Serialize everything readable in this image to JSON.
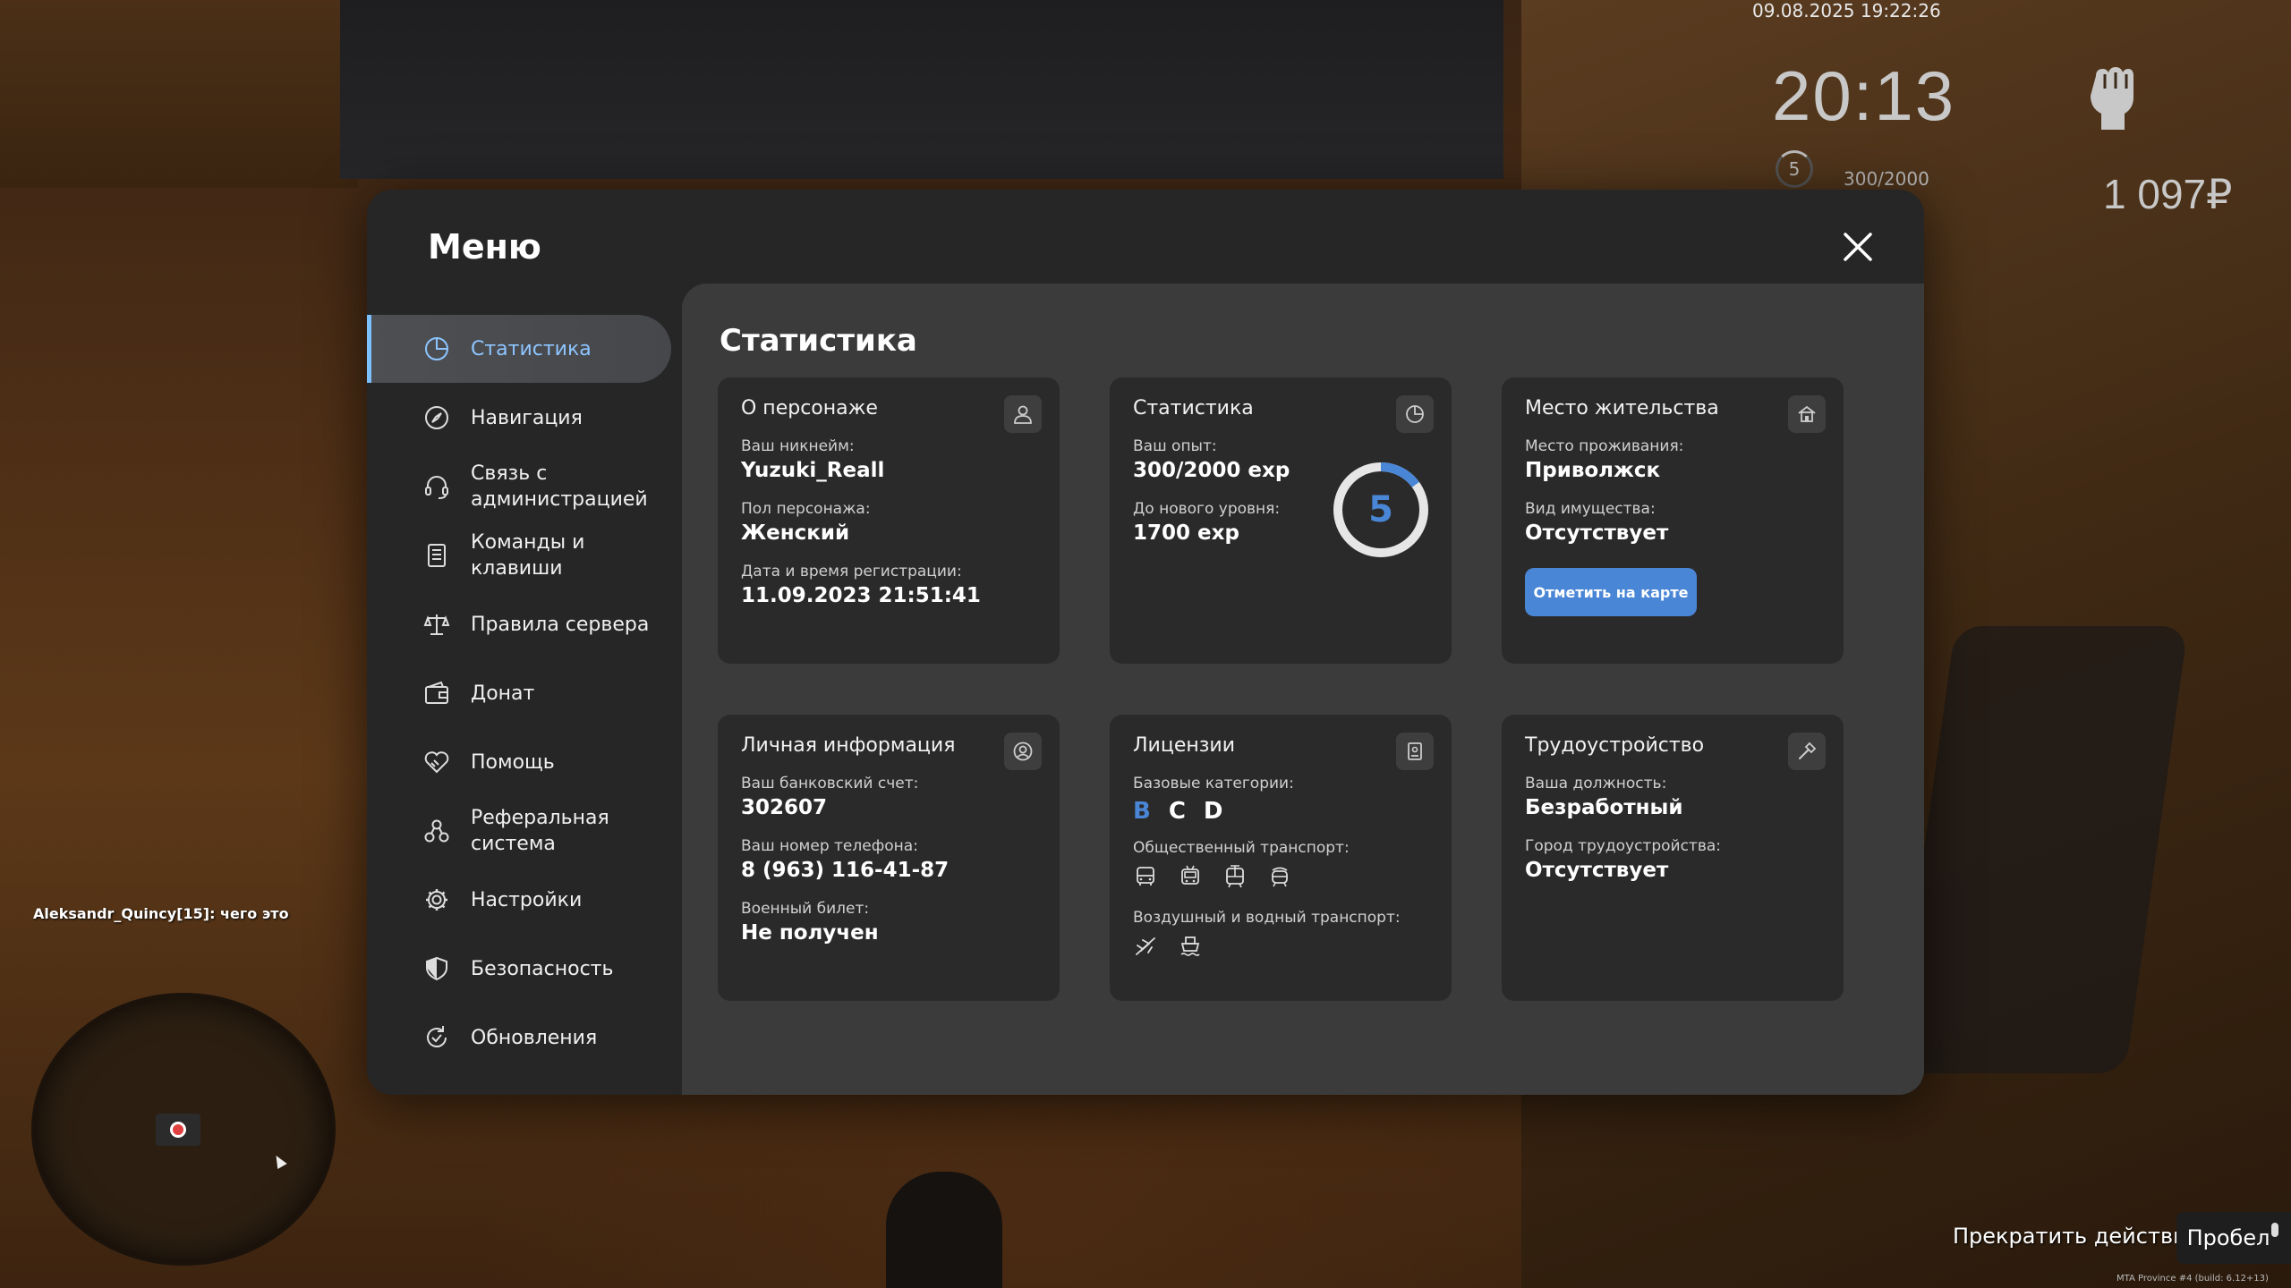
{
  "hud": {
    "datetime": "09.08.2025 19:22:26",
    "time": "20:13",
    "level": "5",
    "exp": "300/2000",
    "money": "1 097₽",
    "chat_line": "Aleksandr_Quincy[15]: чего это",
    "hint_text": "Прекратить действие",
    "hint_key": "Пробел",
    "build": "MTA Province #4 (build: 6.12+13)"
  },
  "menu": {
    "title": "Меню",
    "sidebar": [
      {
        "label": "Статистика",
        "icon": "stats-icon",
        "active": true
      },
      {
        "label": "Навигация",
        "icon": "compass-icon"
      },
      {
        "label": "Связь с\nадминистрацией",
        "icon": "headset-icon"
      },
      {
        "label": "Команды и\nклавиши",
        "icon": "document-icon"
      },
      {
        "label": "Правила сервера",
        "icon": "scales-icon"
      },
      {
        "label": "Донат",
        "icon": "wallet-icon"
      },
      {
        "label": "Помощь",
        "icon": "handshake-heart-icon"
      },
      {
        "label": "Реферальная\nсистема",
        "icon": "referral-icon"
      },
      {
        "label": "Настройки",
        "icon": "gear-icon"
      },
      {
        "label": "Безопасность",
        "icon": "shield-icon"
      },
      {
        "label": "Обновления",
        "icon": "update-icon"
      }
    ]
  },
  "stats": {
    "title": "Статистика",
    "character": {
      "title": "О персонаже",
      "nickname_label": "Ваш никнейм:",
      "nickname": "Yuzuki_Reall",
      "gender_label": "Пол персонажа:",
      "gender": "Женский",
      "reg_label": "Дата и время регистрации:",
      "reg": "11.09.2023 21:51:41"
    },
    "statistics": {
      "title": "Статистика",
      "exp_label": "Ваш опыт:",
      "exp": "300/2000 exp",
      "next_label": "До нового уровня:",
      "next": "1700 exp",
      "level": "5",
      "progress": 0.15
    },
    "residence": {
      "title": "Место жительства",
      "place_label": "Место проживания:",
      "place": "Приволжск",
      "property_label": "Вид имущества:",
      "property": "Отсутствует",
      "button": "Отметить на карте"
    },
    "personal": {
      "title": "Личная информация",
      "bank_label": "Ваш банковский счет:",
      "bank": "302607",
      "phone_label": "Ваш номер телефона:",
      "phone": "8 (963) 116-41-87",
      "military_label": "Военный билет:",
      "military": "Не получен"
    },
    "licenses": {
      "title": "Лицензии",
      "base_label": "Базовые категории:",
      "categories": [
        "B",
        "C",
        "D"
      ],
      "public_label": "Общественный транспорт:",
      "air_label": "Воздушный и водный транспорт:"
    },
    "employment": {
      "title": "Трудоустройство",
      "position_label": "Ваша должность:",
      "position": "Безработный",
      "city_label": "Город трудоустройства:",
      "city": "Отсутствует"
    }
  },
  "colors": {
    "accent": "#4a86d6",
    "active_text": "#8ec5ff"
  }
}
